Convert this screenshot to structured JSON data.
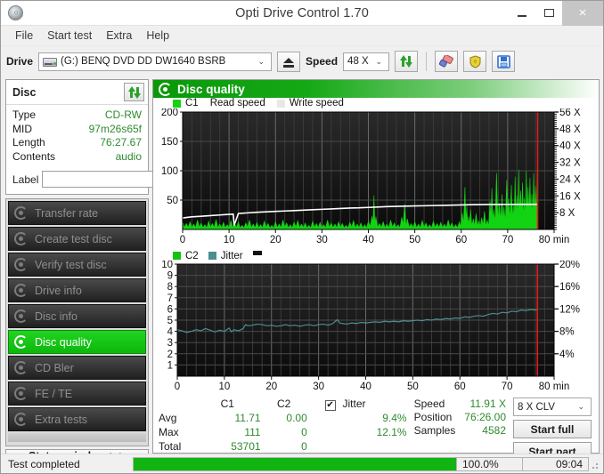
{
  "window": {
    "title": "Opti Drive Control 1.70",
    "app_icon": "disc-icon",
    "minimize": "–",
    "maximize": "□",
    "close": "×"
  },
  "menu": {
    "items": [
      "File",
      "Start test",
      "Extra",
      "Help"
    ]
  },
  "toolbar": {
    "drive_label": "Drive",
    "drive_value": "(G:)   BENQ DVD DD DW1640 BSRB",
    "eject_icon": "eject-icon",
    "speed_label": "Speed",
    "speed_value": "48 X",
    "refresh_icon": "refresh-icon",
    "eraser_icon": "eraser-icon",
    "shield_icon": "shield-icon",
    "save_icon": "save-icon",
    "caret": "⌄"
  },
  "disc_panel": {
    "title": "Disc",
    "refresh_icon": "refresh-icon",
    "rows": [
      {
        "key": "Type",
        "value": "CD-RW"
      },
      {
        "key": "MID",
        "value": "97m26s65f"
      },
      {
        "key": "Length",
        "value": "76:27.67"
      },
      {
        "key": "Contents",
        "value": "audio"
      }
    ],
    "label_key": "Label",
    "label_value": "",
    "label_placeholder": "",
    "label_icon": "cd-icon"
  },
  "sidebar": {
    "items": [
      {
        "label": "Transfer rate",
        "active": false
      },
      {
        "label": "Create test disc",
        "active": false
      },
      {
        "label": "Verify test disc",
        "active": false
      },
      {
        "label": "Drive info",
        "active": false
      },
      {
        "label": "Disc info",
        "active": false
      },
      {
        "label": "Disc quality",
        "active": true
      },
      {
        "label": "CD Bler",
        "active": false
      },
      {
        "label": "FE / TE",
        "active": false
      },
      {
        "label": "Extra tests",
        "active": false
      }
    ],
    "status_window_button": "Status window > >"
  },
  "main": {
    "header_title": "Disc quality",
    "header_icon": "disc-quality-icon"
  },
  "stats": {
    "col_headers": [
      "C1",
      "C2"
    ],
    "jitter_label": "Jitter",
    "jitter_checked": true,
    "check_glyph": "✔",
    "rows": [
      {
        "label": "Avg",
        "c1": "11.71",
        "c2": "0.00",
        "jitter": "9.4%"
      },
      {
        "label": "Max",
        "c1": "111",
        "c2": "0",
        "jitter": "12.1%"
      },
      {
        "label": "Total",
        "c1": "53701",
        "c2": "0",
        "jitter": ""
      }
    ],
    "right": [
      {
        "label": "Speed",
        "value": "11.91 X"
      },
      {
        "label": "Position",
        "value": "76:26.00"
      },
      {
        "label": "Samples",
        "value": "4582"
      }
    ],
    "write_strategy": "8 X CLV",
    "start_full": "Start full",
    "start_part": "Start part"
  },
  "statusbar": {
    "status": "Test completed",
    "progress_percent_label": "100.0%",
    "progress_value": 100,
    "elapsed": "09:04"
  },
  "colors": {
    "c1_green": "#12d412",
    "c2_green": "#12c412",
    "jitter_teal": "#4d8d91",
    "read_speed_white": "#ffffff",
    "marker_red": "#e01b1b",
    "plot_bg": "#161616",
    "accent_green": "#089808"
  },
  "chart_data": [
    {
      "id": "c1-chart",
      "type": "area",
      "title": "C1 / Read speed",
      "xlabel": "min",
      "ylabel": "",
      "xlim": [
        0,
        80
      ],
      "ylim": [
        0,
        200
      ],
      "y2lim": [
        0,
        56
      ],
      "xticks": [
        0,
        10,
        20,
        30,
        40,
        50,
        60,
        70,
        80
      ],
      "xticklabels": [
        "0",
        "10",
        "20",
        "30",
        "40",
        "50",
        "60",
        "70",
        "80 min"
      ],
      "yticks": [
        50,
        100,
        150,
        200
      ],
      "yticklabels": [
        "50",
        "100",
        "150",
        "200"
      ],
      "y2ticks": [
        8,
        16,
        24,
        32,
        40,
        48,
        56
      ],
      "y2ticklabels": [
        "8 X",
        "16 X",
        "24 X",
        "32 X",
        "40 X",
        "48 X",
        "56 X"
      ],
      "grid": true,
      "legend": [
        "C1",
        "Read speed",
        "Write speed"
      ],
      "legend_position": "top-left",
      "end_marker_x": 76.45,
      "series": [
        {
          "name": "C1",
          "color": "#12d412",
          "kind": "area",
          "x": [
            0,
            0.8,
            1.6,
            2.4,
            3.2,
            4,
            4.8,
            5.6,
            6.4,
            7.2,
            8,
            8.8,
            9.6,
            10.4,
            11.2,
            12,
            12.8,
            13.6,
            14.4,
            15.2,
            16,
            16.8,
            17.6,
            18.4,
            19.2,
            20,
            20.8,
            21.6,
            22.4,
            23.2,
            24,
            24.8,
            25.6,
            26.4,
            27.2,
            28,
            28.8,
            29.6,
            30.4,
            31.2,
            32,
            32.8,
            33.6,
            34.4,
            35.2,
            36,
            36.8,
            37.6,
            38.4,
            39.2,
            40,
            40.8,
            41.2,
            41.6,
            42.4,
            43.2,
            44,
            44.8,
            45.6,
            46.4,
            47.2,
            47.8,
            48.4,
            49.2,
            50,
            50.8,
            51.6,
            52.4,
            53.2,
            54,
            54.8,
            55.6,
            56.4,
            57.2,
            58,
            58.8,
            59.6,
            60.2,
            60.8,
            61.2,
            61.6,
            62,
            62.6,
            63.2,
            63.8,
            64.4,
            65,
            65.6,
            66.2,
            66.6,
            67,
            67.6,
            68.2,
            68.8,
            69.2,
            69.8,
            70.2,
            70.8,
            71.2,
            71.6,
            72,
            72.4,
            72.8,
            73.2,
            73.6,
            74,
            74.4,
            74.8,
            75.2,
            75.6,
            76,
            76.4
          ],
          "values": [
            14,
            10,
            13,
            9,
            16,
            11,
            8,
            14,
            10,
            17,
            9,
            12,
            8,
            15,
            10,
            13,
            7,
            11,
            16,
            9,
            12,
            8,
            14,
            10,
            7,
            13,
            9,
            16,
            11,
            8,
            12,
            15,
            9,
            11,
            7,
            14,
            10,
            12,
            8,
            16,
            11,
            9,
            13,
            10,
            7,
            12,
            15,
            9,
            11,
            8,
            14,
            23,
            58,
            22,
            10,
            13,
            9,
            16,
            11,
            8,
            21,
            43,
            18,
            10,
            13,
            9,
            15,
            11,
            8,
            14,
            10,
            12,
            9,
            16,
            11,
            8,
            13,
            28,
            72,
            40,
            22,
            34,
            18,
            27,
            15,
            20,
            31,
            16,
            48,
            70,
            34,
            96,
            45,
            60,
            38,
            84,
            52,
            76,
            44,
            90,
            58,
            102,
            66,
            80,
            54,
            100,
            72,
            88,
            60,
            96,
            74,
            108,
            112
          ]
        },
        {
          "name": "Read speed",
          "color": "#ffffff",
          "kind": "line",
          "axis": "y2",
          "x": [
            0,
            2,
            4,
            6,
            8,
            10,
            10.9,
            11.1,
            12,
            14,
            16,
            18,
            20,
            22,
            24,
            26,
            28,
            30,
            32,
            34,
            36,
            38,
            40,
            42,
            44,
            46,
            48,
            50,
            52,
            54,
            56,
            58,
            60,
            62,
            64,
            66,
            68,
            70,
            72,
            74,
            76,
            76.4
          ],
          "values": [
            5.5,
            6.0,
            6.3,
            6.6,
            6.9,
            7.2,
            7.3,
            2.0,
            7.6,
            7.9,
            8.2,
            8.4,
            8.6,
            8.8,
            9.0,
            9.2,
            9.4,
            9.6,
            9.8,
            10.0,
            10.2,
            10.3,
            10.5,
            10.7,
            10.9,
            11.0,
            11.1,
            11.2,
            11.3,
            11.4,
            11.5,
            11.6,
            11.7,
            11.8,
            11.85,
            11.9,
            11.92,
            11.93,
            11.94,
            11.95,
            11.95,
            11.95
          ]
        }
      ]
    },
    {
      "id": "c2-jitter-chart",
      "type": "line",
      "title": "C2 / Jitter",
      "xlabel": "min",
      "ylabel": "",
      "xlim": [
        0,
        80
      ],
      "ylim": [
        0,
        10
      ],
      "y2lim": [
        0,
        20
      ],
      "xticks": [
        0,
        10,
        20,
        30,
        40,
        50,
        60,
        70,
        80
      ],
      "xticklabels": [
        "0",
        "10",
        "20",
        "30",
        "40",
        "50",
        "60",
        "70",
        "80 min"
      ],
      "yticks": [
        1,
        2,
        3,
        4,
        5,
        6,
        7,
        8,
        9,
        10
      ],
      "yticklabels": [
        "1",
        "2",
        "3",
        "4",
        "5",
        "6",
        "7",
        "8",
        "9",
        "10"
      ],
      "y2ticks": [
        4,
        8,
        12,
        16,
        20
      ],
      "y2ticklabels": [
        "4%",
        "8%",
        "12%",
        "16%",
        "20%"
      ],
      "grid": true,
      "legend": [
        "C2",
        "Jitter"
      ],
      "legend_position": "top-left",
      "end_marker_x": 76.45,
      "series": [
        {
          "name": "C2",
          "color": "#12c412",
          "kind": "area",
          "x": [
            0,
            80
          ],
          "values": [
            0,
            0
          ]
        },
        {
          "name": "Jitter",
          "color": "#4d8d91",
          "kind": "line",
          "axis": "y2",
          "x": [
            0,
            1,
            2,
            3,
            4,
            5,
            6,
            7,
            8,
            9,
            10,
            11,
            11.5,
            12,
            13,
            14,
            14.5,
            15,
            16,
            17,
            18,
            19,
            20,
            21,
            22,
            23,
            24,
            25,
            26,
            27,
            28,
            29,
            30,
            31,
            32,
            33,
            34,
            34.5,
            35,
            36,
            37,
            38,
            39,
            40,
            41,
            42,
            43,
            44,
            45,
            46,
            47,
            48,
            49,
            50,
            51,
            52,
            53,
            54,
            55,
            56,
            57,
            58,
            59,
            60,
            61,
            62,
            63,
            64,
            65,
            66,
            67,
            68,
            69,
            70,
            71,
            72,
            73,
            74,
            75,
            76,
            76.4
          ],
          "values": [
            8.3,
            8.1,
            7.8,
            8.0,
            8.3,
            8.1,
            8.5,
            8.2,
            7.9,
            8.2,
            8.0,
            8.6,
            7.9,
            8.3,
            8.1,
            8.5,
            9.2,
            9.0,
            9.1,
            9.3,
            9.2,
            9.0,
            9.1,
            8.9,
            9.0,
            9.2,
            9.0,
            9.1,
            8.9,
            9.1,
            9.2,
            9.0,
            9.2,
            9.3,
            9.1,
            9.4,
            10.1,
            9.5,
            9.4,
            9.3,
            9.5,
            9.4,
            9.6,
            9.5,
            9.6,
            9.7,
            9.6,
            9.8,
            9.7,
            9.8,
            9.7,
            9.9,
            9.8,
            9.9,
            10.0,
            9.9,
            10.1,
            10.0,
            10.2,
            10.1,
            10.3,
            10.2,
            10.4,
            10.3,
            10.6,
            10.5,
            10.7,
            10.8,
            10.7,
            11.0,
            11.2,
            11.1,
            11.4,
            11.3,
            11.6,
            11.5,
            11.8,
            11.7,
            11.9,
            11.8,
            11.9,
            11.85
          ]
        }
      ]
    }
  ]
}
